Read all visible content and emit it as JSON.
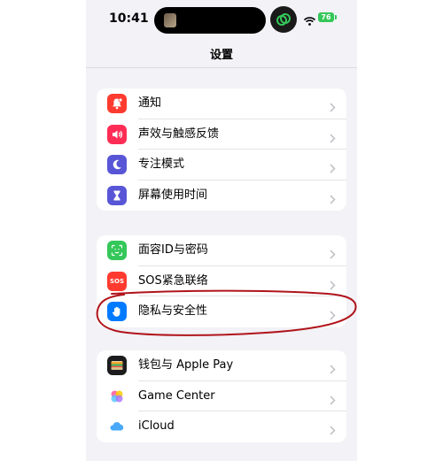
{
  "status_bar": {
    "time": "10:41",
    "battery_level": "76",
    "battery_color": "#34c759",
    "icons": [
      "now-playing-thumbnail",
      "linked-app-icon",
      "wifi-icon",
      "battery-icon"
    ]
  },
  "nav": {
    "title": "设置"
  },
  "groups": [
    {
      "items": [
        {
          "label": "通知",
          "icon": "bell-icon",
          "color": "#ff3b30"
        },
        {
          "label": "声效与触感反馈",
          "icon": "speaker-icon",
          "color": "#ff2d55"
        },
        {
          "label": "专注模式",
          "icon": "moon-icon",
          "color": "#5856d6"
        },
        {
          "label": "屏幕使用时间",
          "icon": "hourglass-icon",
          "color": "#5856d6"
        }
      ]
    },
    {
      "items": [
        {
          "label": "面容ID与密码",
          "icon": "face-id-icon",
          "color": "#34c759"
        },
        {
          "label": "SOS紧急联络",
          "icon": "sos-icon",
          "color": "#ff3b30",
          "icon_text": "SOS"
        },
        {
          "label": "隐私与安全性",
          "icon": "hand-icon",
          "color": "#007aff",
          "highlighted": true
        }
      ]
    },
    {
      "items": [
        {
          "label": "钱包与 Apple Pay",
          "icon": "wallet-icon",
          "color": "#1c1c1e"
        },
        {
          "label": "Game Center",
          "icon": "game-center-icon",
          "color": "#ffffff"
        },
        {
          "label": "iCloud",
          "icon": "icloud-icon",
          "color": "#ffffff"
        }
      ]
    }
  ],
  "annotation": {
    "shape": "hand-drawn ellipse",
    "color": "#b0141b",
    "target": "隐私与安全性"
  }
}
